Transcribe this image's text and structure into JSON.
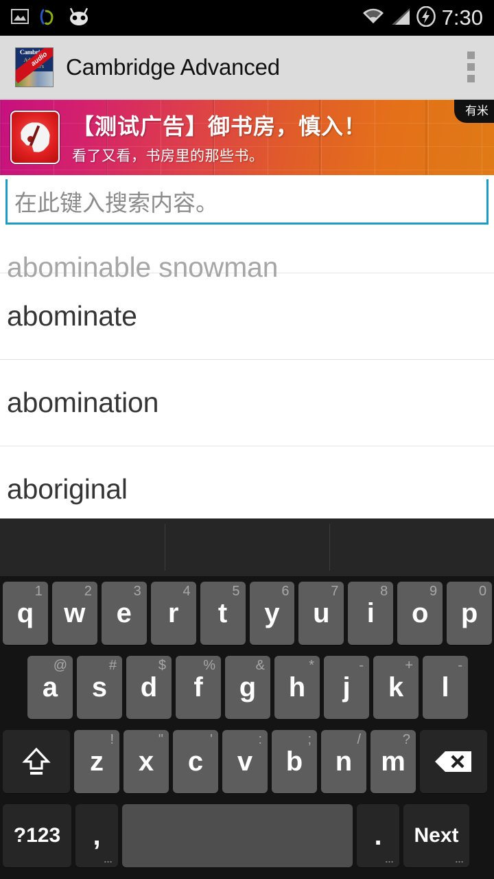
{
  "statusbar": {
    "icons": [
      "gallery-image-icon",
      "headset-icon",
      "cyanogenmod-icon",
      "wifi-icon",
      "cellular-signal-icon",
      "battery-charging-icon"
    ],
    "time": "7:30"
  },
  "actionbar": {
    "app_icon": {
      "name": "cambridge-dictionary-book-icon",
      "line1": "Cambridge",
      "line2": "Advanced",
      "line3": "Learner's",
      "ribbon": "audio"
    },
    "title": "Cambridge Advanced",
    "overflow_label": "overflow-menu",
    "bg_color": "#dcdcdc"
  },
  "ad": {
    "icon_name": "palette-app-icon",
    "title": "【测试广告】御书房，慎入！",
    "subtitle": "看了又看，书房里的那些书。",
    "tag": "有米",
    "gradient_from": "#c6107f",
    "gradient_to": "#df7a16"
  },
  "search": {
    "placeholder": "在此键入搜索内容。",
    "value": "",
    "underline_color": "#1b9cc4"
  },
  "results": [
    {
      "word": "abominable snowman",
      "clipped": true
    },
    {
      "word": "abominate",
      "clipped": false
    },
    {
      "word": "abomination",
      "clipped": false
    },
    {
      "word": "aboriginal",
      "clipped": false
    }
  ],
  "keyboard": {
    "suggestions": [
      "",
      "",
      ""
    ],
    "rows": [
      [
        {
          "main": "q",
          "sup": "1"
        },
        {
          "main": "w",
          "sup": "2"
        },
        {
          "main": "e",
          "sup": "3"
        },
        {
          "main": "r",
          "sup": "4"
        },
        {
          "main": "t",
          "sup": "5"
        },
        {
          "main": "y",
          "sup": "6"
        },
        {
          "main": "u",
          "sup": "7"
        },
        {
          "main": "i",
          "sup": "8"
        },
        {
          "main": "o",
          "sup": "9"
        },
        {
          "main": "p",
          "sup": "0"
        }
      ],
      [
        {
          "main": "a",
          "sup": "@"
        },
        {
          "main": "s",
          "sup": "#"
        },
        {
          "main": "d",
          "sup": "$"
        },
        {
          "main": "f",
          "sup": "%"
        },
        {
          "main": "g",
          "sup": "&"
        },
        {
          "main": "h",
          "sup": "*"
        },
        {
          "main": "j",
          "sup": "-"
        },
        {
          "main": "k",
          "sup": "+"
        },
        {
          "main": "l",
          "sup": "-"
        }
      ],
      [
        {
          "main": "",
          "sup": "",
          "icon": "shift-icon"
        },
        {
          "main": "z",
          "sup": "!"
        },
        {
          "main": "x",
          "sup": "\""
        },
        {
          "main": "c",
          "sup": "'"
        },
        {
          "main": "v",
          "sup": ":"
        },
        {
          "main": "b",
          "sup": ";"
        },
        {
          "main": "n",
          "sup": "/"
        },
        {
          "main": "m",
          "sup": "?"
        },
        {
          "main": "",
          "sup": "",
          "icon": "backspace-icon"
        }
      ],
      [
        {
          "main": "?123",
          "sup": ""
        },
        {
          "main": ",",
          "sup": "",
          "dots": "…"
        },
        {
          "main": "",
          "sup": "",
          "icon": "space-key"
        },
        {
          "main": ".",
          "sup": "",
          "dots": "…"
        },
        {
          "main": "Next",
          "sup": "",
          "dots": "…"
        }
      ]
    ],
    "key_color": "#5d5d5d",
    "mod_key_color": "#262626",
    "bg_color": "#141414"
  }
}
